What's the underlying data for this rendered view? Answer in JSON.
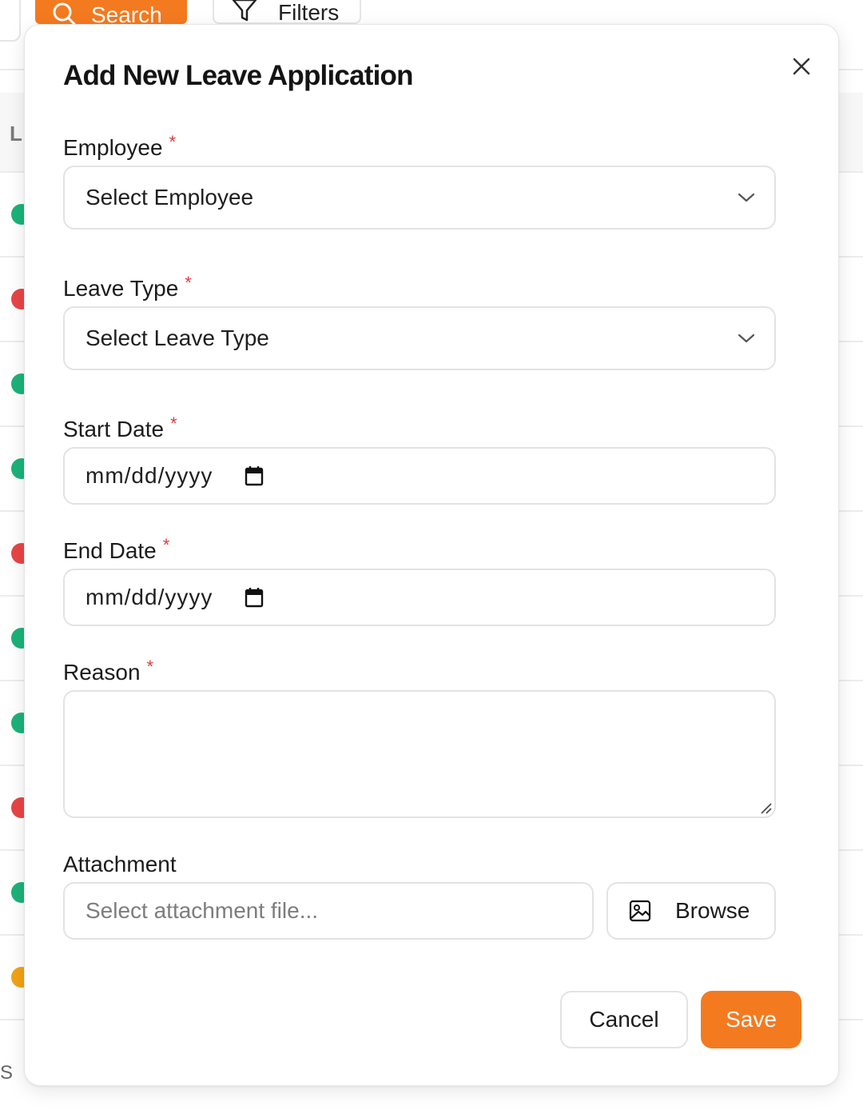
{
  "background": {
    "search_button_label": "Search",
    "filters_button_label": "Filters",
    "column_header_letter": "L",
    "footer_fragment": "S",
    "status_dot_colors": [
      "#1bb37a",
      "#e84545",
      "#1bb37a",
      "#1bb37a",
      "#e84545",
      "#1bb37a",
      "#1bb37a",
      "#e84545",
      "#1bb37a",
      "#f2a314"
    ]
  },
  "modal": {
    "title": "Add New Leave Application",
    "close_icon": "close-icon",
    "fields": {
      "employee": {
        "label": "Employee",
        "required_mark": "*",
        "placeholder": "Select Employee"
      },
      "leave_type": {
        "label": "Leave Type",
        "required_mark": "*",
        "placeholder": "Select Leave Type"
      },
      "start_date": {
        "label": "Start Date",
        "required_mark": "*",
        "placeholder": "mm/dd/yyyy"
      },
      "end_date": {
        "label": "End Date",
        "required_mark": "*",
        "placeholder": "mm/dd/yyyy"
      },
      "reason": {
        "label": "Reason",
        "required_mark": "*",
        "value": ""
      },
      "attachment": {
        "label": "Attachment",
        "placeholder": "Select attachment file...",
        "browse_label": "Browse"
      }
    },
    "actions": {
      "cancel_label": "Cancel",
      "save_label": "Save"
    },
    "colors": {
      "accent": "#f47a20",
      "required": "#e23b3b"
    }
  }
}
